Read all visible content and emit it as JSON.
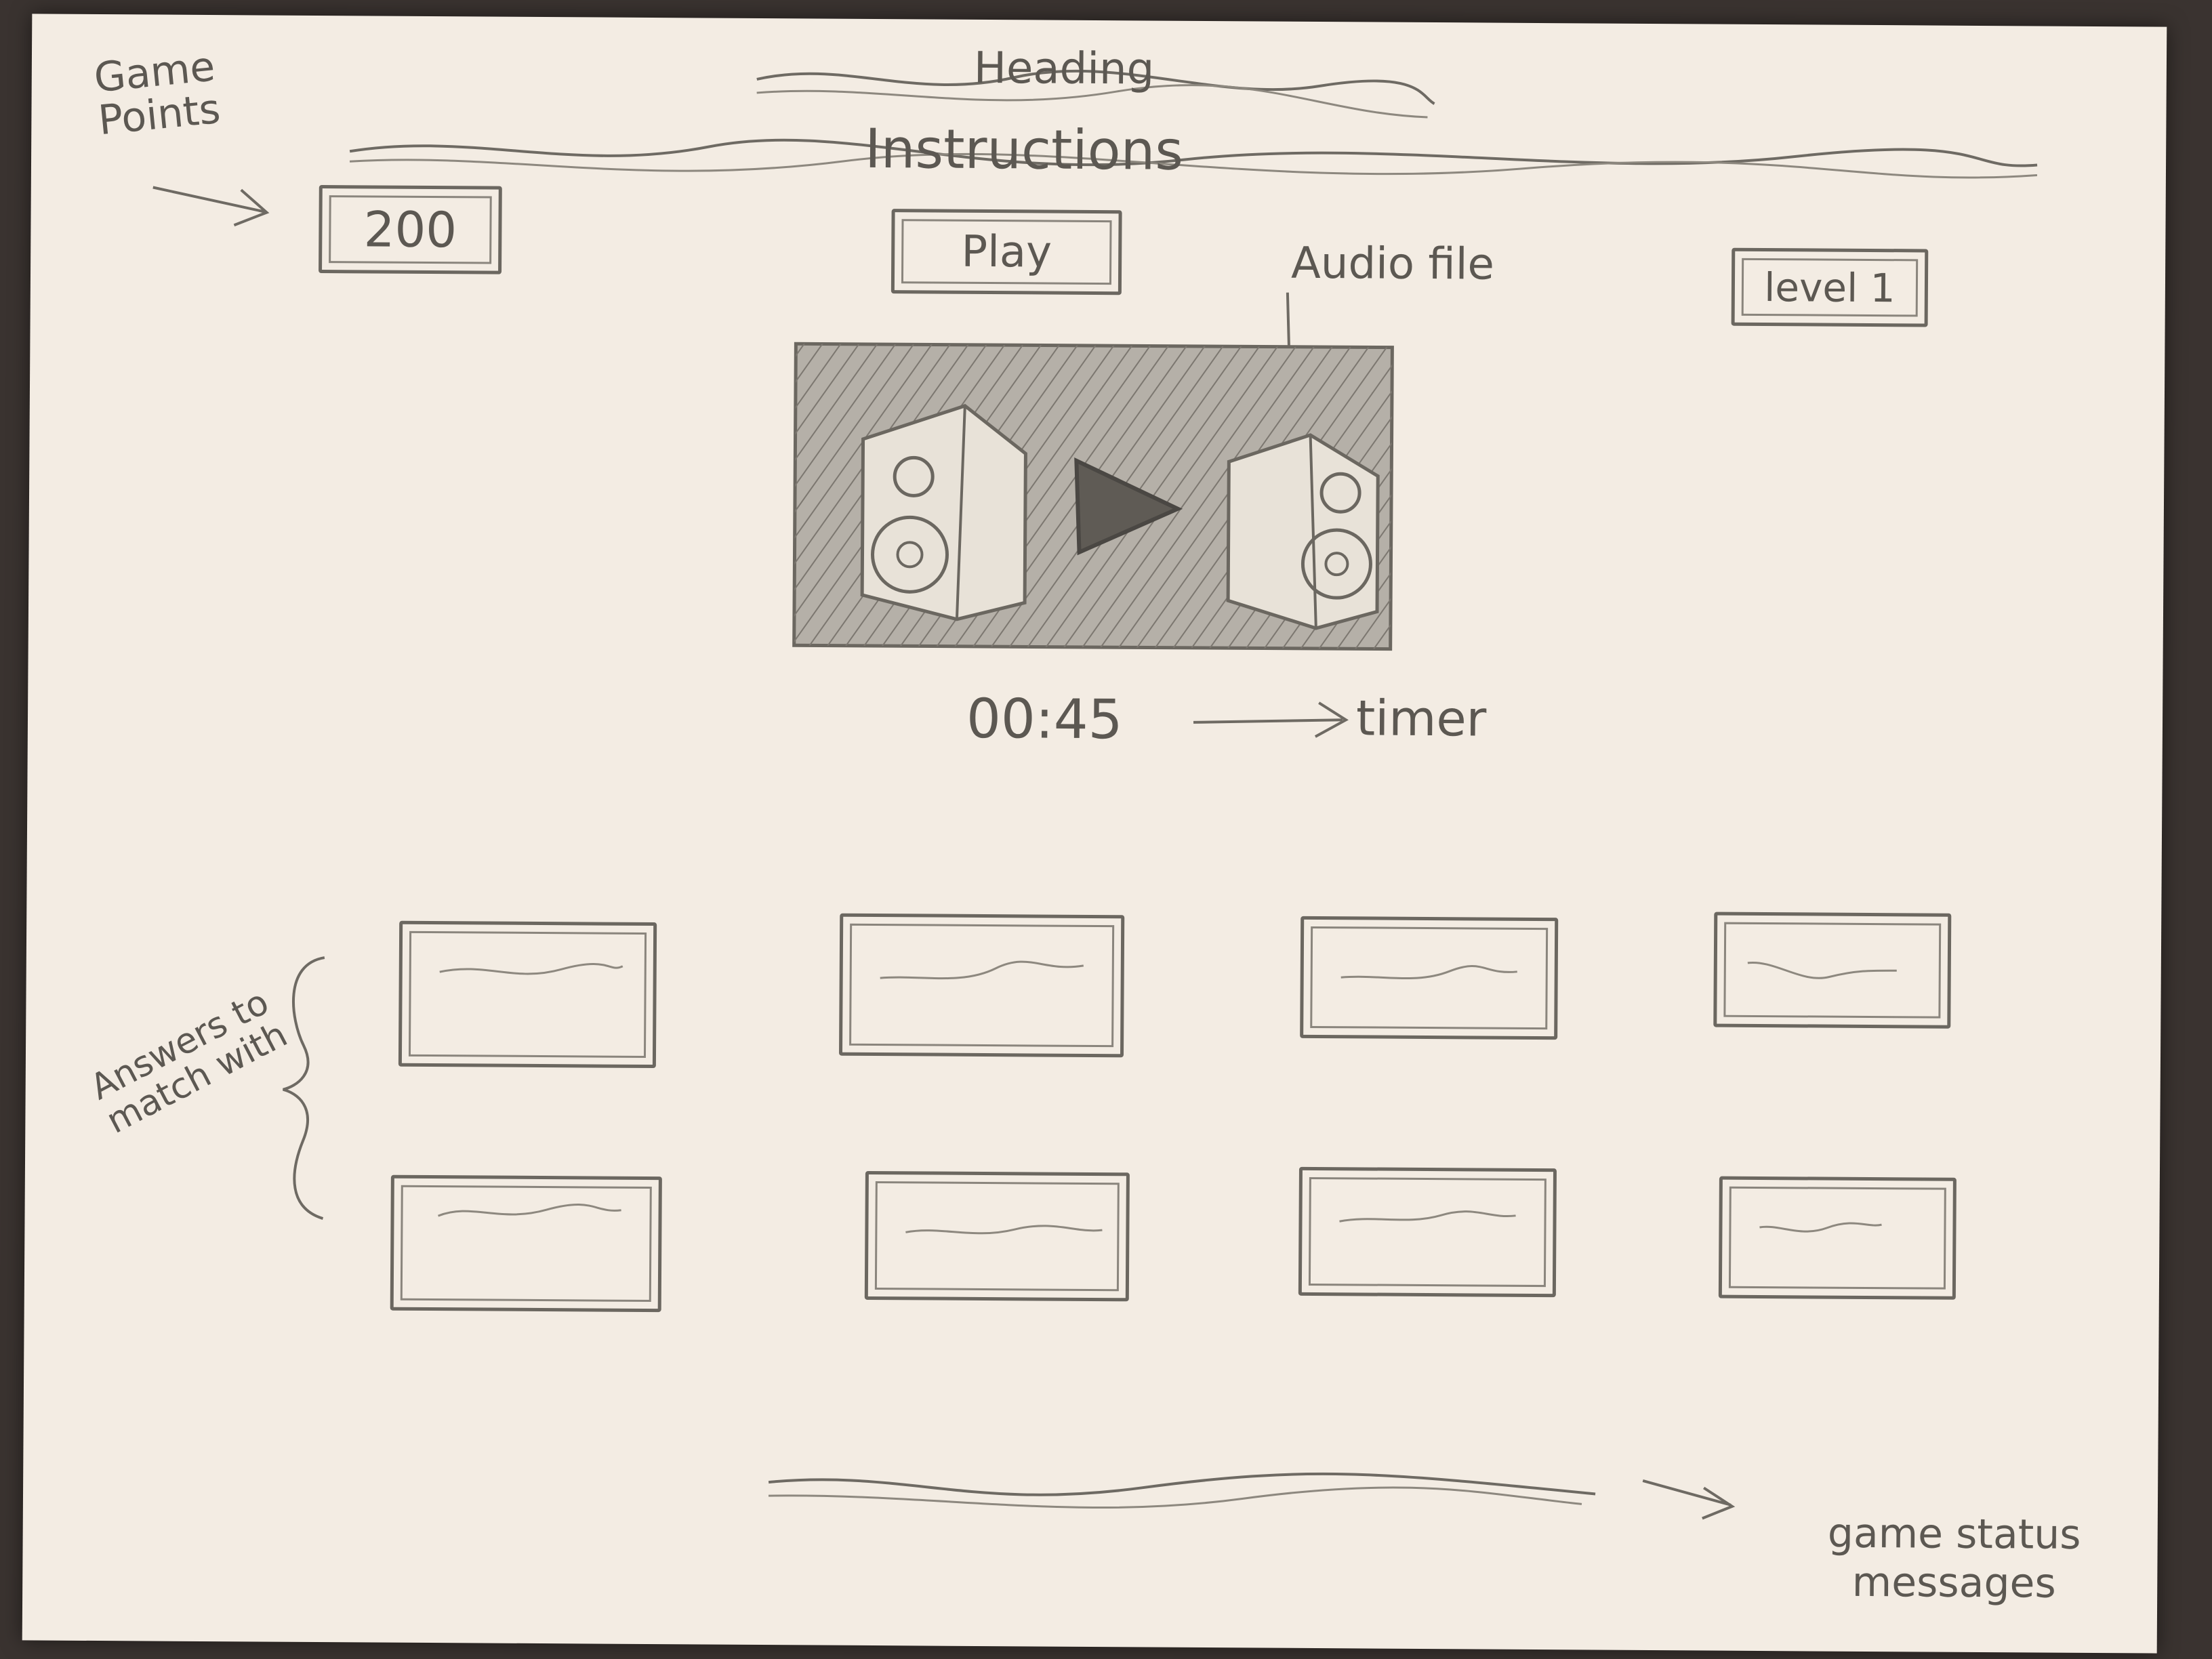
{
  "header": {
    "heading_label": "Heading",
    "instructions_label": "Instructions"
  },
  "points": {
    "annotation": "Game Points",
    "value": "200"
  },
  "play_button": {
    "label": "Play"
  },
  "level": {
    "label": "level 1"
  },
  "audio": {
    "annotation": "Audio file",
    "icon": "play-icon"
  },
  "timer": {
    "value": "00:45",
    "annotation": "timer"
  },
  "answers": {
    "annotation": "Answers to match with",
    "items": [
      "",
      "",
      "",
      "",
      "",
      "",
      "",
      ""
    ]
  },
  "status": {
    "annotation": "game status messages"
  }
}
